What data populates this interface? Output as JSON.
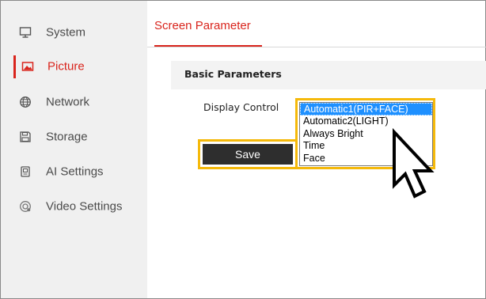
{
  "sidebar": {
    "items": [
      {
        "label": "System",
        "icon": "monitor-icon",
        "active": false
      },
      {
        "label": "Picture",
        "icon": "image-icon",
        "active": true
      },
      {
        "label": "Network",
        "icon": "globe-icon",
        "active": false
      },
      {
        "label": "Storage",
        "icon": "save-disk-icon",
        "active": false
      },
      {
        "label": "AI Settings",
        "icon": "chip-icon",
        "active": false
      },
      {
        "label": "Video Settings",
        "icon": "camera-icon",
        "active": false
      }
    ]
  },
  "main": {
    "tab": "Screen Parameter",
    "section_title": "Basic Parameters",
    "display_control": {
      "label": "Display Control",
      "options": [
        "Automatic1(PIR+FACE)",
        "Automatic2(LIGHT)",
        "Always Bright",
        "Time",
        "Face"
      ],
      "selected": "Automatic1(PIR+FACE)"
    },
    "save_label": "Save"
  },
  "colors": {
    "accent": "#d9251d",
    "highlight_outline": "#f5b90a",
    "selected_option": "#1e90ff",
    "sidebar_bg": "#f0f0f0",
    "save_button": "#2e2e2e"
  }
}
